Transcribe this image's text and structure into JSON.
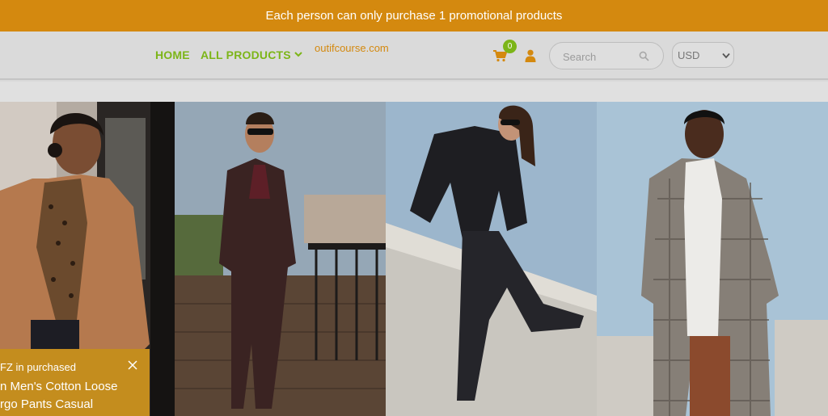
{
  "promo": {
    "text": "Each person can only purchase 1 promotional products"
  },
  "header": {
    "nav": [
      {
        "label": "HOME"
      },
      {
        "label": "ALL PRODUCTS"
      }
    ],
    "logo": "outifcourse.com",
    "cart_count": "0",
    "search": {
      "placeholder": "Search"
    },
    "currency": {
      "selected": "USD"
    }
  },
  "gallery": [
    {
      "subject": "woman in camel blazer and leopard print blouse"
    },
    {
      "subject": "man in burgundy suit with sunglasses on terrace"
    },
    {
      "subject": "woman in black suit sitting on stone wall"
    },
    {
      "subject": "man in plaid overcoat and white hoodie"
    }
  ],
  "toast": {
    "user_text": "FZ in purchased",
    "line1": "n Men's Cotton Loose",
    "line2": "rgo Pants Casual"
  },
  "colors": {
    "promo": "#d4890f",
    "nav": "#7cb518",
    "logo": "#d4890f",
    "toast": "#c48d1e"
  },
  "icons": [
    "chevron-down-icon",
    "cart-icon",
    "user-icon",
    "search-icon",
    "close-icon"
  ]
}
